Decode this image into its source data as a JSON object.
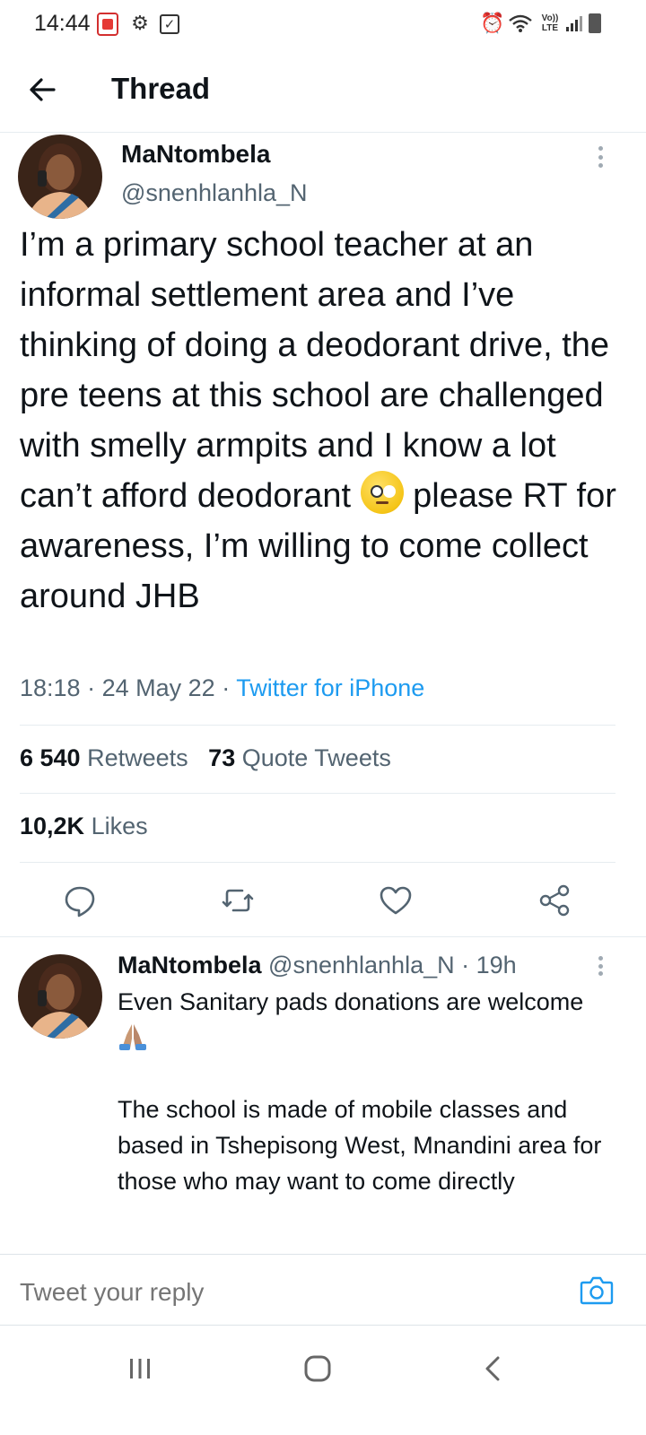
{
  "status_bar": {
    "time": "14:44",
    "network_label": "Vo)) LTE",
    "icons": [
      "pdf-app-icon",
      "gear-icon",
      "checkbox-icon",
      "alarm-icon",
      "wifi-icon",
      "volte-icon",
      "signal-icon",
      "battery-icon"
    ]
  },
  "header": {
    "title": "Thread",
    "back_icon": "arrow-left-icon"
  },
  "main_tweet": {
    "display_name": "MaNtombela",
    "handle": "@snenhlanhla_N",
    "text_before_emoji": "I’m a primary school teacher at an informal settlement area and I’ve thinking of doing a deodorant drive, the pre teens at this school are challenged with smelly armpits and I know a lot can’t afford deodorant ",
    "emoji": "face-with-rolling-eyes",
    "text_after_emoji": " please RT for awareness, I’m willing to come collect around JHB",
    "time": "18:18",
    "date": "24 May 22",
    "separator": "·",
    "source": "Twitter for iPhone",
    "retweets_count": "6 540",
    "retweets_label": "Retweets",
    "quotes_count": "73",
    "quotes_label": "Quote Tweets",
    "likes_count": "10,2K",
    "likes_label": "Likes",
    "actions": [
      "reply-icon",
      "retweet-icon",
      "like-icon",
      "share-icon"
    ]
  },
  "reply_tweet": {
    "display_name": "MaNtombela",
    "handle": "@snenhlanhla_N",
    "separator": "·",
    "age": "19h",
    "text_line1": "Even Sanitary pads donations are welcome ",
    "emoji": "folded-hands",
    "text_rest": "\n\nThe school is made of mobile classes and based in Tshepisong West, Mnandini area for those who may want to come directly"
  },
  "composer": {
    "placeholder": "Tweet your reply",
    "camera_icon": "camera-icon"
  },
  "navbar": {
    "buttons": [
      "recent-apps-icon",
      "home-icon",
      "back-icon"
    ]
  },
  "colors": {
    "accent": "#1d9bf0",
    "text_primary": "#0f1419",
    "text_secondary": "#536471",
    "divider": "#e6ecf0"
  }
}
